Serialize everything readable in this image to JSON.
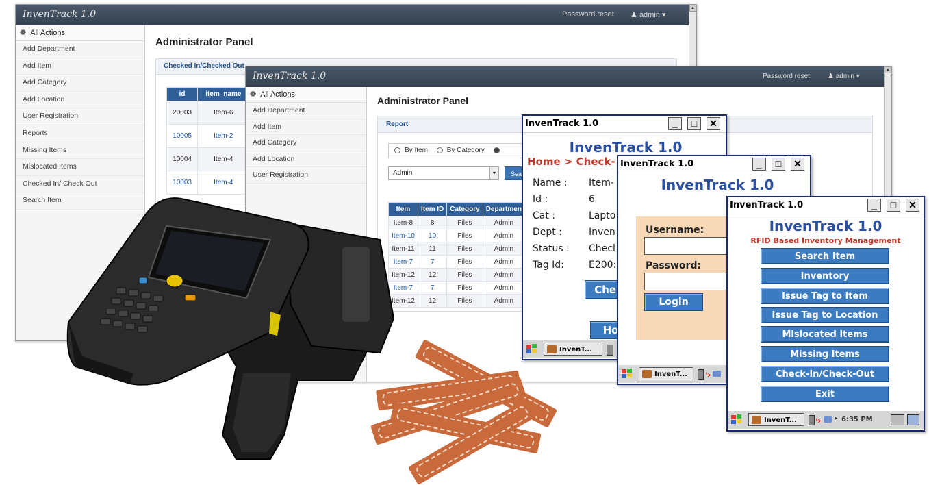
{
  "brand": "InvenTrack 1.0",
  "nav": {
    "password_reset": "Password reset",
    "user": "admin"
  },
  "sidebar": {
    "header": "All Actions",
    "items": [
      "Add Department",
      "Add Item",
      "Add Category",
      "Add Location",
      "User Registration",
      "Reports",
      "Missing Items",
      "Mislocated Items",
      "Checked In/ Check Out",
      "Search Item"
    ]
  },
  "sidebar2": {
    "header": "All Actions",
    "items": [
      "Add Department",
      "Add Item",
      "Add Category",
      "Add Location",
      "User Registration"
    ]
  },
  "panel_title": "Administrator Panel",
  "win1": {
    "subhead": "Checked In/Checked Out",
    "columns": [
      "id",
      "item_name",
      "it"
    ],
    "rows": [
      [
        "20003",
        "Item-6"
      ],
      [
        "10005",
        "Item-2"
      ],
      [
        "10004",
        "Item-4"
      ],
      [
        "10003",
        "Item-4"
      ]
    ]
  },
  "win2": {
    "subhead": "Report",
    "radios": [
      "By Item",
      "By Category"
    ],
    "select_value": "Admin",
    "search_label": "Sea",
    "columns": [
      "Item",
      "Item ID",
      "Category",
      "Departmen"
    ],
    "rows": [
      [
        "Item-8",
        "8",
        "Files",
        "Admin"
      ],
      [
        "Item-10",
        "10",
        "Files",
        "Admin"
      ],
      [
        "Item-11",
        "11",
        "Files",
        "Admin"
      ],
      [
        "Item-7",
        "7",
        "Files",
        "Admin"
      ],
      [
        "Item-12",
        "12",
        "Files",
        "Admin"
      ],
      [
        "Item-7",
        "7",
        "Files",
        "Admin"
      ],
      [
        "Item-12",
        "12",
        "Files",
        "Admin"
      ]
    ]
  },
  "ce1": {
    "title": "InvenTrack 1.0",
    "app_title": "InvenTrack 1.0",
    "breadcrumb": "Home > Check-",
    "fields": [
      {
        "label": "Name :",
        "value": "Item-"
      },
      {
        "label": "Id :",
        "value": "6"
      },
      {
        "label": "Cat :",
        "value": "Lapto"
      },
      {
        "label": "Dept :",
        "value": "Inven"
      },
      {
        "label": "Status :",
        "value": "Checl"
      },
      {
        "label": "Tag Id:",
        "value": "E200:"
      }
    ],
    "button1": "Che",
    "button2": "Ho",
    "task_label": "InvenT..."
  },
  "ce2": {
    "title": "InvenTrack 1.0",
    "app_title": "InvenTrack 1.0",
    "username_label": "Username:",
    "password_label": "Password:",
    "login_label": "Login",
    "task_label": "InvenT..."
  },
  "ce3": {
    "title": "InvenTrack 1.0",
    "app_title": "InvenTrack 1.0",
    "subtitle": "RFID Based Inventory Management",
    "menu": [
      "Search Item",
      "Inventory",
      "Issue Tag to Item",
      "Issue Tag to Location",
      "Mislocated Items",
      "Missing Items",
      "Check-In/Check-Out",
      "Exit"
    ],
    "task_label": "InvenT...",
    "clock": "6:35 PM"
  },
  "colors": {
    "navbar": "#3d4a5a",
    "ce_blue": "#3c7bbf",
    "ce_title": "#2a4fa3",
    "accent_red": "#c0392b"
  }
}
